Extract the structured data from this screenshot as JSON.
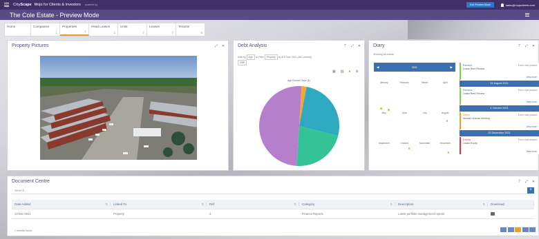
{
  "topbar": {
    "brand_city": "City",
    "brand_scape": "Scape",
    "app_title": "Mojo for Clients & Investors",
    "powered_by": "powered by",
    "exit_button": "Exit Preview Mode",
    "user_email": "sales@mojoclients.com"
  },
  "page": {
    "title": "The Cole Estate - Preview Mode"
  },
  "tabs": [
    {
      "label": "Home",
      "count": ""
    },
    {
      "label": "Companies",
      "count": "1"
    },
    {
      "label": "Properties",
      "count": "1"
    },
    {
      "label": "Head Leases",
      "count": "1"
    },
    {
      "label": "Units",
      "count": "7"
    },
    {
      "label": "Leases",
      "count": "7"
    },
    {
      "label": "Tenants",
      "count": "6"
    }
  ],
  "pictures": {
    "title": "Property Pictures"
  },
  "debt": {
    "title": "Debt Analysis",
    "filter_group": "Debt by",
    "filter_age": "Age",
    "filter_on": "on Filter",
    "filter_property": "Property",
    "filter_note": "as at 8 June 2021 (All Currency)",
    "filter_currency": "GBP",
    "pie_title": "Age Bucket Days (£)"
  },
  "chart_data": {
    "type": "pie",
    "title": "Age Bucket Days (£)",
    "slices": [
      {
        "value": 50,
        "color": "#b57fcb"
      },
      {
        "value": 22,
        "color": "#33c496"
      },
      {
        "value": 26,
        "color": "#2ea9bf"
      },
      {
        "value": 2,
        "color": "#f0a830"
      }
    ]
  },
  "diary": {
    "title": "Diary",
    "showing": "Showing all events",
    "calendar_year": "2021",
    "months": [
      "January",
      "February",
      "March",
      "April",
      "May",
      "June",
      "July",
      "August",
      "September",
      "October",
      "November",
      "December"
    ],
    "events": [
      {
        "kind": "event",
        "title": "Review",
        "sub": "Lease Rent Review",
        "status": "Event date passed",
        "link": "View more"
      },
      {
        "kind": "date",
        "label": "31 August 2021"
      },
      {
        "kind": "event",
        "title": "Review",
        "sub": "Lease Rent Review",
        "status": "Event date passed",
        "link": "View more"
      },
      {
        "kind": "date",
        "label": "4 October 2021"
      },
      {
        "kind": "event",
        "title": "Other",
        "sub": "Annual General Meeting",
        "status": "Event date passed",
        "link": "View more",
        "accent": "orange"
      },
      {
        "kind": "date",
        "label": "20 December 2021"
      },
      {
        "kind": "event",
        "title": "Expiry",
        "sub": "Lease Expiry",
        "status": "Event date passed",
        "link": "View more",
        "accent": "red"
      }
    ]
  },
  "docs": {
    "title": "Document Centre",
    "search_placeholder": "Search...",
    "columns": [
      "Date Added",
      "Linked To",
      "Ref",
      "Category",
      "Description",
      "Download"
    ],
    "rows": [
      {
        "date": "10 Dec 2021",
        "linked": "Property",
        "ref": "3",
        "category": "Finance Reports",
        "description": "Latest portfolio management reports"
      }
    ],
    "records_found": "1 records found"
  }
}
